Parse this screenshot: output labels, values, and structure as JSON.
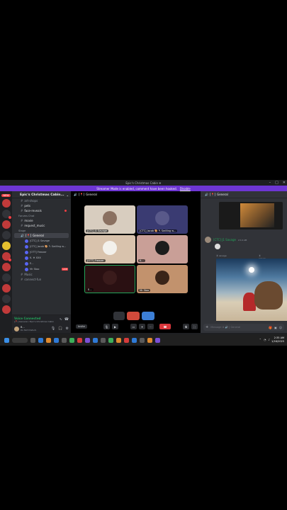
{
  "window": {
    "title": "Epic's Christmas Cabin ❄",
    "controls": [
      "–",
      "□",
      "✕"
    ]
  },
  "streamer_bar": {
    "message": "Streamer Mode is enabled, comment have been hooked.",
    "action": "Disable"
  },
  "server_rail": {
    "new_badge": "NEW"
  },
  "sidebar": {
    "server_name": "Epic's Christmas Cabin...",
    "channels_top": [
      {
        "label": "art-shops"
      },
      {
        "label": "pets"
      },
      {
        "label": "face-reveals"
      }
    ],
    "category_1": "Forums Chat",
    "channels_mid": [
      {
        "label": "movie"
      },
      {
        "label": "request_music"
      }
    ],
    "category_2": "Stage",
    "active_channel": {
      "label": "General",
      "tag": "[📍]",
      "sub": "Epic's Christmas Cabin ❄"
    },
    "voice_users": [
      {
        "name": "[CTC] J1 Savage"
      },
      {
        "name": "[CTC] Jacob 🎨 ✎ Swilling w..."
      },
      {
        "name": "[OTT] Freezer"
      },
      {
        "name": "K. ❄ XXX"
      },
      {
        "name": "E..."
      },
      {
        "name": "Mr Stoo",
        "tag": "LIVE"
      }
    ],
    "channels_bottom": [
      {
        "label": "Music"
      },
      {
        "label": "connect-fun"
      }
    ],
    "voice_panel": {
      "status": "Voice Connected",
      "sub": "[📍] General / Epic's Christmas Cabin"
    },
    "user": {
      "name": "B...",
      "status": "Do Not Disturb"
    }
  },
  "call": {
    "header_tag": "[📍]",
    "header_name": "General",
    "tiles": [
      {
        "label": "[CTC] J1 Savage"
      },
      {
        "label": "[CTC] Jacob 🎨 ✎ Swilling w..."
      },
      {
        "label": "[OTT] Freezer"
      },
      {
        "label": "K..."
      },
      {
        "label": "E..."
      },
      {
        "label": "Mr Stoo"
      }
    ],
    "dont_show": "Don't show again",
    "invite_label": "Invite"
  },
  "chat": {
    "header_tag": "[📍]",
    "header_name": "General",
    "author": "[CTC] J1 Savage",
    "time": "2:14 AM",
    "reply_left": "Ⓡ savage",
    "reply_right": "Ⓡ jolnuts",
    "composer_placeholder": "Message # 🔊 | General"
  },
  "taskbar": {
    "clock_time": "2:35 AM",
    "clock_date": "1/16/2025"
  },
  "colors": {
    "accent": "#6e36d4",
    "online": "#23a55a",
    "danger": "#da373c"
  }
}
